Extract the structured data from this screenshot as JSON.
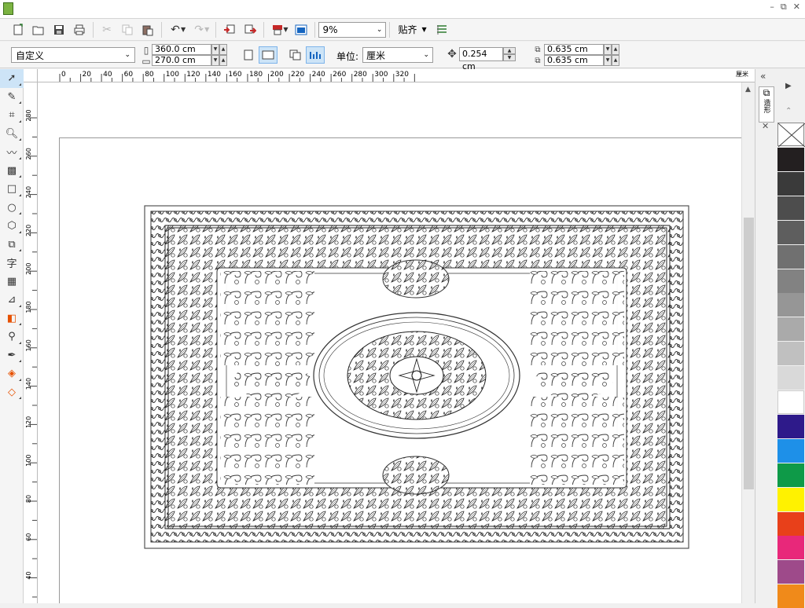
{
  "app": {
    "window_controls": [
      "–",
      "⧉",
      "✕"
    ]
  },
  "toolbar": {
    "buttons": [
      "new-document",
      "open",
      "save",
      "print",
      "cut",
      "copy",
      "paste",
      "undo",
      "redo",
      "import",
      "export",
      "publish-to-pdf",
      "app-launcher"
    ],
    "zoom_value": "9%",
    "snap_label": "贴齐"
  },
  "propbar": {
    "preset_value": "自定义",
    "width_value": "360.0 cm",
    "height_value": "270.0 cm",
    "unit_label": "单位:",
    "unit_value": "厘米",
    "nudge_value": "0.254 cm",
    "dup_x_value": "0.635 cm",
    "dup_y_value": "0.635 cm"
  },
  "ruler": {
    "h_ticks": [
      "0",
      "20",
      "40",
      "60",
      "80",
      "100",
      "120",
      "140",
      "160",
      "180",
      "200",
      "220",
      "240",
      "260",
      "280",
      "300",
      "320"
    ],
    "h_unit": "厘米",
    "v_ticks": [
      "280",
      "260",
      "240",
      "220",
      "200",
      "180",
      "160",
      "140",
      "120",
      "100",
      "80",
      "60",
      "40"
    ]
  },
  "docker": {
    "tab_label": "造形"
  },
  "palette": {
    "colors": [
      "#231f20",
      "#3a3a3a",
      "#4d4d4d",
      "#5e5e5e",
      "#707070",
      "#828282",
      "#969696",
      "#aaaaaa",
      "#c0c0c0",
      "#d9d9d9",
      "#ffffff",
      "#2e1a8a",
      "#1e90e8",
      "#0e9a48",
      "#fff200",
      "#e8401a",
      "#e8287a",
      "#9e4a8a",
      "#f08a1a"
    ]
  },
  "tools": [
    "pick",
    "shape",
    "crop",
    "zoom",
    "freehand",
    "smart-fill",
    "rectangle",
    "ellipse",
    "polygon",
    "basic-shapes",
    "text",
    "table",
    "parallel-dimension",
    "eyedropper",
    "outline-pen",
    "interactive-fill",
    "smart-fill-2"
  ]
}
